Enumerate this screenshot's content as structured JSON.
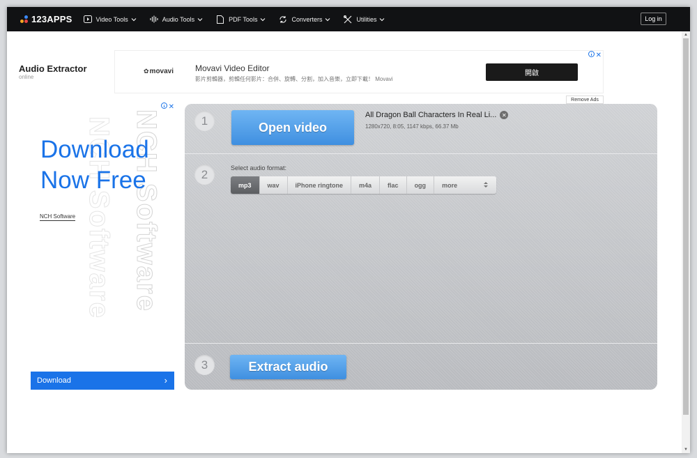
{
  "nav": {
    "logo": "123APPS",
    "items": [
      {
        "label": "Video Tools"
      },
      {
        "label": "Audio Tools"
      },
      {
        "label": "PDF Tools"
      },
      {
        "label": "Converters"
      },
      {
        "label": "Utilities"
      }
    ],
    "login": "Log in"
  },
  "page": {
    "title": "Audio Extractor",
    "subtitle": "online"
  },
  "top_ad": {
    "brand": "movavi",
    "title": "Movavi Video Editor",
    "description": "影片剪輯器，剪輯任何影片：合併、旋轉、分割，加入音樂，立即下載！ Movavi",
    "button": "開啟",
    "remove_ads": "Remove Ads"
  },
  "side_ad": {
    "line1": "Download",
    "line2": "Now Free",
    "vendor": "NCH Software",
    "watermark": "NCH Software",
    "cta": "Download"
  },
  "tool": {
    "step1": "1",
    "step2": "2",
    "step3": "3",
    "open_button": "Open video",
    "file_name": "All Dragon Ball Characters In Real Li...",
    "file_meta": "1280x720, 8:05, 1147 kbps, 66.37 Mb",
    "format_label": "Select audio format:",
    "formats": [
      "mp3",
      "wav",
      "iPhone ringtone",
      "m4a",
      "flac",
      "ogg"
    ],
    "selected_format": "mp3",
    "more": "more",
    "extract_button": "Extract audio"
  },
  "colors": {
    "nav_bg": "#111214",
    "accent_blue": "#1a73e8",
    "button_blue": "#4f9be6"
  }
}
